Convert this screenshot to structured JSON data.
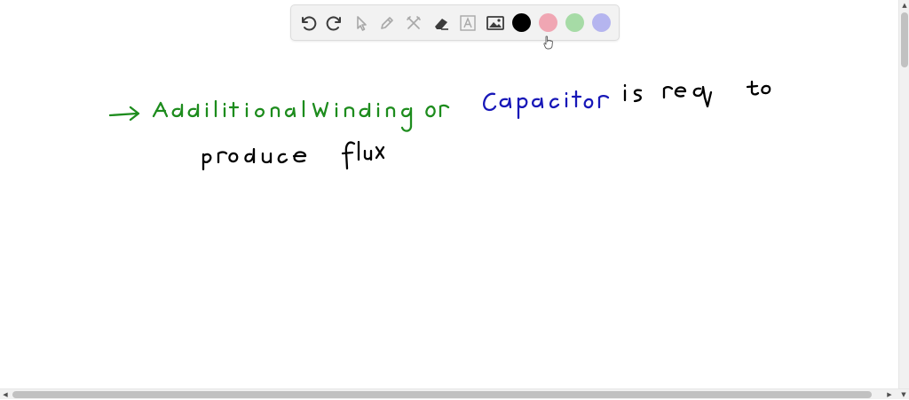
{
  "toolbar": {
    "tools": [
      {
        "name": "undo-icon",
        "enabled": true
      },
      {
        "name": "redo-icon",
        "enabled": true
      },
      {
        "name": "pointer-icon",
        "enabled": false
      },
      {
        "name": "pencil-icon",
        "enabled": false
      },
      {
        "name": "tools-icon",
        "enabled": false
      },
      {
        "name": "eraser-icon",
        "enabled": true
      },
      {
        "name": "text-icon",
        "enabled": false
      },
      {
        "name": "image-icon",
        "enabled": true
      }
    ],
    "colors": [
      {
        "name": "black",
        "hex": "#000000",
        "selected": true
      },
      {
        "name": "red",
        "hex": "#f0a6b3",
        "selected": false
      },
      {
        "name": "green",
        "hex": "#a6dba6",
        "selected": false
      },
      {
        "name": "blue",
        "hex": "#b5b5ef",
        "selected": false
      }
    ]
  },
  "handwriting": {
    "line1_green": "Additional winding or",
    "line1_blue": "Capacitor",
    "line1_black": "is req to",
    "line2_black": "produce flux"
  },
  "ink_colors": {
    "green": "#1d8c1d",
    "blue": "#1818b8",
    "black": "#000000"
  }
}
